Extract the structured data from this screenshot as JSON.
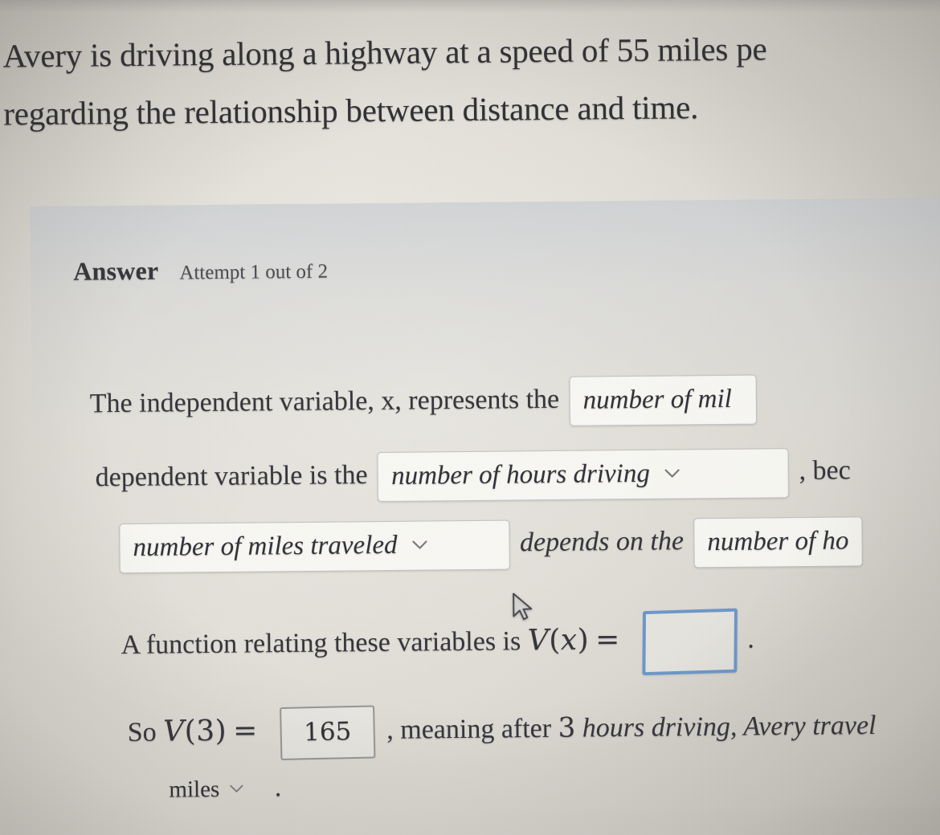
{
  "problem": {
    "line1": "Avery is driving along a highway at a speed of 55 miles pe",
    "line2": "regarding the relationship between distance and time."
  },
  "answer_panel": {
    "heading": "Answer",
    "attempt": "Attempt 1 out of 2",
    "independent": {
      "lead": "The independent variable, x, represents the",
      "select_value": "number of mil"
    },
    "dependent": {
      "lead": "dependent variable is the",
      "select_value": "number of hours driving",
      "trail": ", bec"
    },
    "because": {
      "select_value_1": "number of miles traveled",
      "middle": "depends on the",
      "select_value_2": "number of ho"
    },
    "function": {
      "lead": "A function relating these variables is",
      "math_fn": "V",
      "math_open": "(",
      "math_var": "x",
      "math_close": ")",
      "math_eq": "=",
      "input_value": "",
      "period": "."
    },
    "evaluation": {
      "so": "So",
      "math_fn": "V",
      "math_open": "(",
      "math_arg": "3",
      "math_close": ")",
      "math_eq": "=",
      "answer_value": "165",
      "mid_text": ", meaning after",
      "hours_value": "3",
      "trail_text": "hours driving, Avery travel",
      "unit_select_value": "miles",
      "final_period": "."
    }
  },
  "icons": {
    "chevron_down": "chevron-down-icon",
    "cursor": "mouse-cursor-arrow"
  },
  "colors": {
    "page_background": "#d8d5ce",
    "panel_background": "#c9ced4",
    "text": "#33333a",
    "active_input_border": "#6c96c8",
    "input_border": "#76767a"
  }
}
